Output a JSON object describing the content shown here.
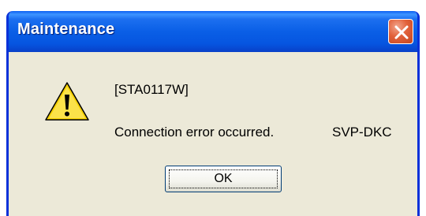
{
  "window": {
    "title": "Maintenance",
    "close_icon": "close-icon"
  },
  "message": {
    "icon": "warning-icon",
    "code": "[STA0117W]",
    "text": "Connection error occurred.",
    "source": "SVP-DKC"
  },
  "buttons": {
    "ok_label": "OK"
  },
  "colors": {
    "titlebar": "#0a5fe6",
    "frame": "#0831d9",
    "dialog_bg": "#ece9d8",
    "close_button": "#e2613a",
    "warning_yellow": "#f5d000"
  }
}
